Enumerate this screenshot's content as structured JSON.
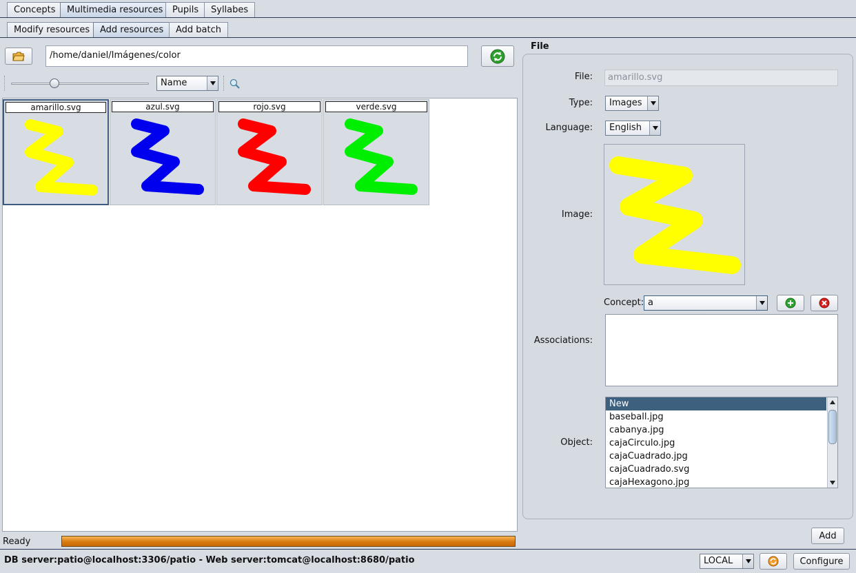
{
  "top_tabs": [
    "Concepts",
    "Multimedia resources",
    "Pupils",
    "Syllabes"
  ],
  "sub_tabs": [
    "Modify resources",
    "Add resources",
    "Add batch"
  ],
  "path_value": "/home/daniel/Imágenes/color",
  "sort": {
    "selected": "Name"
  },
  "zoom_slider_fraction": 0.3,
  "files": [
    {
      "name": "amarillo.svg",
      "color": "#ffff00"
    },
    {
      "name": "azul.svg",
      "color": "#0000ee"
    },
    {
      "name": "rojo.svg",
      "color": "#ff0000"
    },
    {
      "name": "verde.svg",
      "color": "#00ee00"
    }
  ],
  "panel": {
    "title": "File",
    "file_label": "File:",
    "file_value": "amarillo.svg",
    "type_label": "Type:",
    "type_value": "Images",
    "language_label": "Language:",
    "language_value": "English",
    "image_label": "Image:",
    "image_color": "#ffff00",
    "concept_label": "Concept:",
    "concept_value": "a",
    "associations_label": "Associations:",
    "object_label": "Object:",
    "objects": [
      "New",
      "baseball.jpg",
      "cabanya.jpg",
      "cajaCirculo.jpg",
      "cajaCuadrado.jpg",
      "cajaCuadrado.svg",
      "cajaHexagono.jpg"
    ],
    "add_label": "Add"
  },
  "status": {
    "text": "Ready",
    "progress": 1.0
  },
  "footer": {
    "server_text": "DB server:patio@localhost:3306/patio - Web server:tomcat@localhost:8680/patio",
    "mode_value": "LOCAL",
    "configure_label": "Configure"
  },
  "colors": {
    "selection": "#3d607f",
    "progress": "#e08a1e"
  },
  "icons": [
    "folder-open-icon",
    "refresh-icon",
    "zoom-icon",
    "add-icon",
    "remove-icon",
    "connection-icon"
  ]
}
